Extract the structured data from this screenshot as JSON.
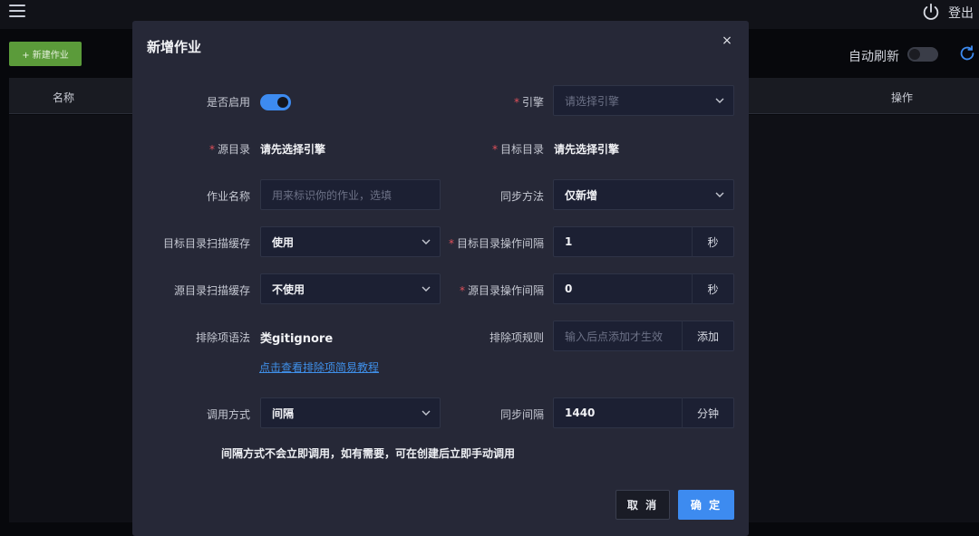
{
  "app": {
    "logout_label": "登出",
    "new_job_label": "+ 新建作业",
    "auto_refresh_label": "自动刷新",
    "table_headers": {
      "name": "名称",
      "operation": "操作"
    }
  },
  "modal": {
    "title": "新增作业",
    "close_label": "×",
    "fields": {
      "enabled": {
        "label": "是否启用",
        "value": true
      },
      "engine": {
        "label": "引擎",
        "required": "*",
        "placeholder": "请选择引擎"
      },
      "source_dir": {
        "label": "源目录",
        "required": "*",
        "value": "请先选择引擎"
      },
      "target_dir": {
        "label": "目标目录",
        "required": "*",
        "value": "请先选择引擎"
      },
      "job_name": {
        "label": "作业名称",
        "placeholder": "用来标识你的作业，选填"
      },
      "sync_method": {
        "label": "同步方法",
        "value": "仅新增"
      },
      "target_scan_cache": {
        "label": "目标目录扫描缓存",
        "value": "使用"
      },
      "target_op_interval": {
        "label": "目标目录操作间隔",
        "required": "*",
        "value": "1",
        "unit": "秒"
      },
      "source_scan_cache": {
        "label": "源目录扫描缓存",
        "value": "不使用"
      },
      "source_op_interval": {
        "label": "源目录操作间隔",
        "required": "*",
        "value": "0",
        "unit": "秒"
      },
      "exclude_syntax": {
        "label": "排除项语法",
        "value": "类gitignore",
        "link": "点击查看排除项简易教程"
      },
      "exclude_rules": {
        "label": "排除项规则",
        "placeholder": "输入后点添加才生效",
        "add_label": "添加"
      },
      "invoke_method": {
        "label": "调用方式",
        "value": "间隔"
      },
      "sync_interval": {
        "label": "同步间隔",
        "value": "1440",
        "unit": "分钟"
      }
    },
    "note": "间隔方式不会立即调用，如有需要，可在创建后立即手动调用",
    "cancel_label": "取 消",
    "ok_label": "确 定"
  },
  "colors": {
    "accent": "#3d8bf0",
    "required": "#e0505a",
    "new_button": "#5b9b3a"
  }
}
